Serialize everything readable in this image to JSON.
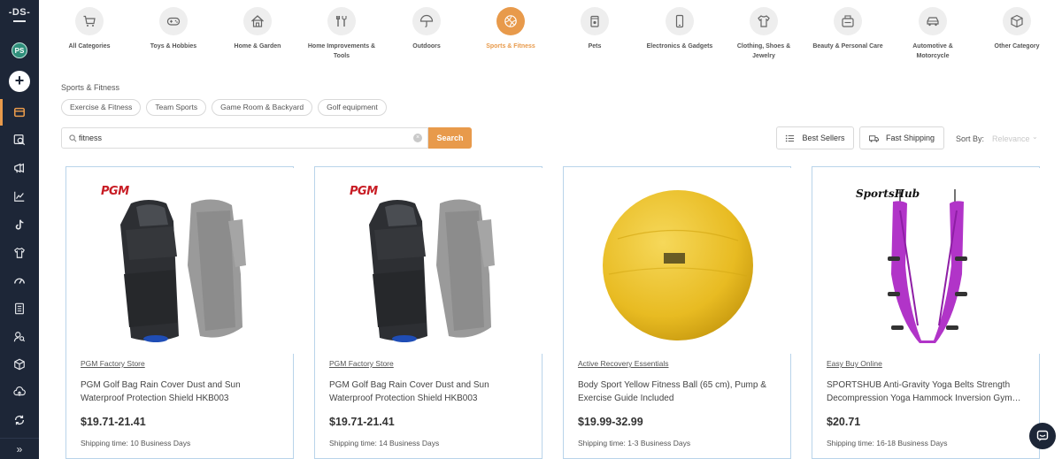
{
  "sidebar": {
    "logo": "DS",
    "avatar": "PS",
    "add_label": "+",
    "items": [
      {
        "icon": "store-icon",
        "active": true
      },
      {
        "icon": "search-products-icon",
        "active": false
      },
      {
        "icon": "megaphone-icon",
        "active": false
      },
      {
        "icon": "analytics-icon",
        "active": false
      },
      {
        "icon": "tiktok-icon",
        "active": false
      },
      {
        "icon": "tshirt-icon",
        "active": false
      },
      {
        "icon": "gauge-icon",
        "active": false
      },
      {
        "icon": "document-icon",
        "active": false
      },
      {
        "icon": "user-search-icon",
        "active": false
      },
      {
        "icon": "box-icon",
        "active": false
      },
      {
        "icon": "cloud-upload-icon",
        "active": false
      },
      {
        "icon": "sync-icon",
        "active": false
      }
    ],
    "collapse_label": "»"
  },
  "categories": [
    {
      "label": "All Categories",
      "icon": "cart-icon",
      "active": false
    },
    {
      "label": "Toys & Hobbies",
      "icon": "gamepad-icon",
      "active": false
    },
    {
      "label": "Home & Garden",
      "icon": "house-icon",
      "active": false
    },
    {
      "label": "Home Improvements & Tools",
      "icon": "tools-icon",
      "active": false
    },
    {
      "label": "Outdoors",
      "icon": "umbrella-icon",
      "active": false
    },
    {
      "label": "Sports & Fitness",
      "icon": "basketball-icon",
      "active": true
    },
    {
      "label": "Pets",
      "icon": "pet-food-icon",
      "active": false
    },
    {
      "label": "Electronics & Gadgets",
      "icon": "phone-icon",
      "active": false
    },
    {
      "label": "Clothing, Shoes & Jewelry",
      "icon": "shirt-icon",
      "active": false
    },
    {
      "label": "Beauty & Personal Care",
      "icon": "cosmetics-icon",
      "active": false
    },
    {
      "label": "Automotive & Motorcycle",
      "icon": "car-icon",
      "active": false
    },
    {
      "label": "Other Category",
      "icon": "cube-icon",
      "active": false
    }
  ],
  "breadcrumb": "Sports & Fitness",
  "subcategories": [
    "Exercise & Fitness",
    "Team Sports",
    "Game Room & Backyard",
    "Golf equipment"
  ],
  "search": {
    "value": "fitness",
    "button": "Search"
  },
  "toolbar": {
    "best_sellers": "Best Sellers",
    "fast_shipping": "Fast Shipping",
    "sort_by": "Sort By:",
    "sort_value": "Relevance"
  },
  "products": [
    {
      "brand_logo": "PGM",
      "store": "PGM Factory Store",
      "title": "PGM Golf Bag Rain Cover Dust and Sun Waterproof Protection Shield HKB003",
      "price": "$19.71-21.41",
      "shipping": "Shipping time: 10 Business Days"
    },
    {
      "brand_logo": "PGM",
      "store": "PGM Factory Store",
      "title": "PGM Golf Bag Rain Cover Dust and Sun Waterproof Protection Shield HKB003",
      "price": "$19.71-21.41",
      "shipping": "Shipping time: 14 Business Days"
    },
    {
      "brand_logo": "",
      "store": "Active Recovery Essentials",
      "title": "Body Sport Yellow Fitness Ball (65 cm), Pump & Exercise Guide Included",
      "price": "$19.99-32.99",
      "shipping": "Shipping time: 1-3 Business Days"
    },
    {
      "brand_logo": "SportsHub",
      "store": "Easy Buy Online",
      "title": "SPORTSHUB Anti-Gravity Yoga Belts Strength Decompression Yoga Hammock Inversion Gym…",
      "price": "$20.71",
      "shipping": "Shipping time: 16-18 Business Days"
    }
  ],
  "colors": {
    "accent": "#e89a4b",
    "sidebar": "#1d2637",
    "card_border": "#b9d4ea"
  }
}
